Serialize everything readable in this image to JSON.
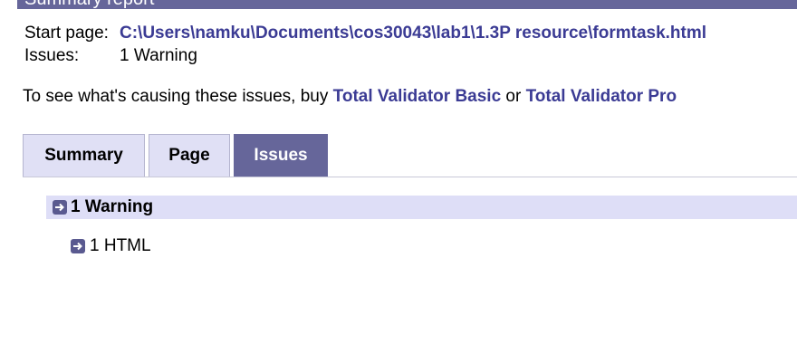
{
  "header": {
    "title": "Summary report"
  },
  "summary": {
    "start_label": "Start page:",
    "start_value": "C:\\Users\\namku\\Documents\\cos30043\\lab1\\1.3P resource\\formtask.html",
    "issues_label": "Issues:",
    "issues_value": "1 Warning"
  },
  "upsell": {
    "prefix": "To see what's causing these issues, buy ",
    "basic_link": "Total Validator Basic",
    "middle": " or ",
    "pro_link": "Total Validator Pro"
  },
  "tabs": [
    {
      "label": "Summary",
      "active": false
    },
    {
      "label": "Page",
      "active": false
    },
    {
      "label": "Issues",
      "active": true
    }
  ],
  "issues_tree": {
    "group_label": "1 Warning",
    "group_icon": "expand-arrow-icon",
    "items": [
      {
        "label": "1 HTML",
        "icon": "expand-arrow-icon"
      }
    ]
  },
  "colors": {
    "accent": "#66669a",
    "link": "#3b3b94",
    "tab_bg": "#e0e0f5",
    "row_highlight": "#dedef7"
  }
}
